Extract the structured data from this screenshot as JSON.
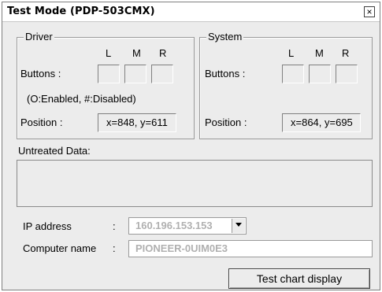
{
  "window": {
    "title": "Test Mode (PDP-503CMX)",
    "close_glyph": "×"
  },
  "driver": {
    "legend": "Driver",
    "columns": [
      "L",
      "M",
      "R"
    ],
    "buttons_label": "Buttons :",
    "note": "(O:Enabled, #:Disabled)",
    "position_label": "Position :",
    "position_value": "x=848, y=611"
  },
  "system": {
    "legend": "System",
    "columns": [
      "L",
      "M",
      "R"
    ],
    "buttons_label": "Buttons :",
    "position_label": "Position :",
    "position_value": "x=864, y=695"
  },
  "untreated": {
    "label": "Untreated Data:"
  },
  "network": {
    "ip_label": "IP address",
    "ip_colon": ":",
    "ip_value": "160.196.153.153",
    "computer_label": "Computer name",
    "computer_colon": ":",
    "computer_value": "PIONEER-0UIM0E3"
  },
  "actions": {
    "test_chart_label": "Test chart display"
  },
  "icons": {
    "close": "close-icon",
    "dropdown": "chevron-down-icon"
  }
}
